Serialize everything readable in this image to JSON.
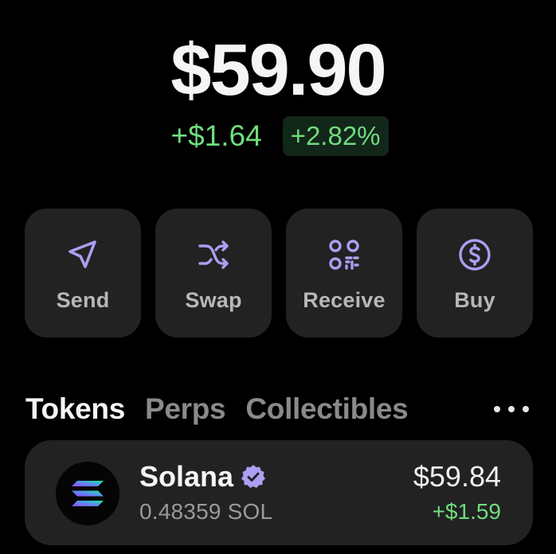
{
  "balance": {
    "total": "$59.90",
    "change_amount": "+$1.64",
    "change_percent": "+2.82%"
  },
  "actions": [
    {
      "label": "Send",
      "icon": "send-icon"
    },
    {
      "label": "Swap",
      "icon": "swap-icon"
    },
    {
      "label": "Receive",
      "icon": "qr-code-icon"
    },
    {
      "label": "Buy",
      "icon": "dollar-circle-icon"
    }
  ],
  "tabs": [
    {
      "label": "Tokens",
      "active": true
    },
    {
      "label": "Perps",
      "active": false
    },
    {
      "label": "Collectibles",
      "active": false
    }
  ],
  "more_icon": "more-horizontal-icon",
  "tokens": [
    {
      "name": "Solana",
      "verified": true,
      "amount": "0.48359 SOL",
      "value": "$59.84",
      "change": "+$1.59",
      "icon": "solana-logo-icon"
    }
  ],
  "colors": {
    "background": "#000000",
    "card": "#222222",
    "accent": "#ab9ff2",
    "positive": "#6fdc7e",
    "positive_bg": "#12261a"
  }
}
